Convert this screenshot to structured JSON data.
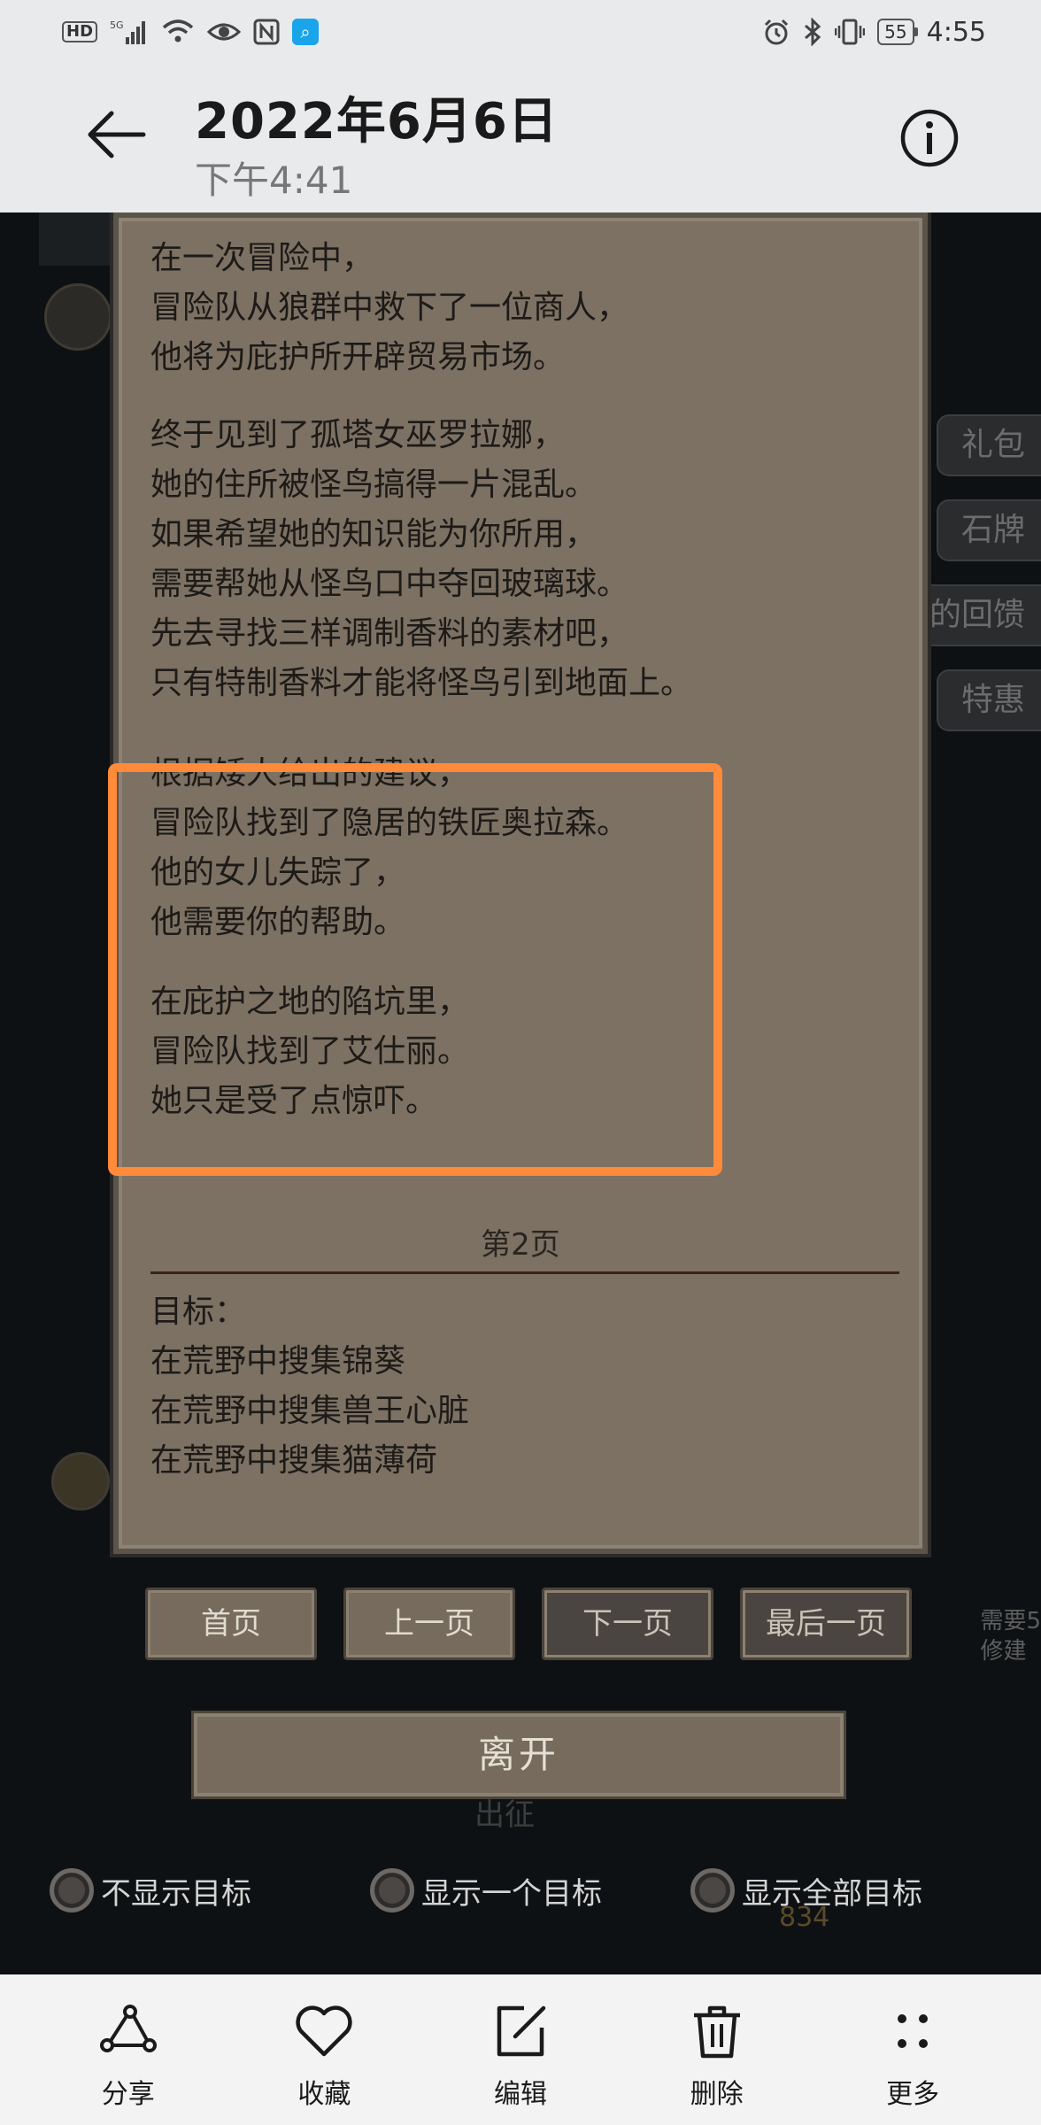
{
  "status_bar": {
    "left_badges": [
      "HD",
      "5G"
    ],
    "time": "4:55",
    "battery": "55"
  },
  "header": {
    "title": "2022年6月6日",
    "subtitle": "下午4:41"
  },
  "game": {
    "side_tags": [
      "礼包",
      "石牌",
      "的回馈",
      "特惠"
    ],
    "story_paragraphs": [
      [
        "在一次冒险中，",
        "冒险队从狼群中救下了一位商人，",
        "他将为庇护所开辟贸易市场。"
      ],
      [
        "终于见到了孤塔女巫罗拉娜，",
        "她的住所被怪鸟搞得一片混乱。",
        "如果希望她的知识能为你所用，",
        "需要帮她从怪鸟口中夺回玻璃球。",
        "先去寻找三样调制香料的素材吧，",
        "只有特制香料才能将怪鸟引到地面上。"
      ],
      [
        "根据矮人给出的建议，",
        "冒险队找到了隐居的铁匠奥拉森。",
        "他的女儿失踪了，",
        "他需要你的帮助。"
      ],
      [
        "在庇护之地的陷坑里，",
        "冒险队找到了艾仕丽。",
        "她只是受了点惊吓。"
      ]
    ],
    "page_label": "第2页",
    "goals_title": "目标：",
    "goals": [
      "在荒野中搜集锦葵",
      "在荒野中搜集兽王心脏",
      "在荒野中搜集猫薄荷"
    ],
    "nav_buttons": [
      "首页",
      "上一页",
      "下一页",
      "最后一页"
    ],
    "leave_button": "离开",
    "behind_text": "出征",
    "filters": [
      "不显示目标",
      "显示一个目标",
      "显示全部目标"
    ],
    "coin_text": "834",
    "right_hint": [
      "需要5",
      "修建"
    ]
  },
  "toolbar": {
    "items": [
      {
        "label": "分享",
        "icon": "share-icon"
      },
      {
        "label": "收藏",
        "icon": "heart-icon"
      },
      {
        "label": "编辑",
        "icon": "edit-icon"
      },
      {
        "label": "删除",
        "icon": "trash-icon"
      },
      {
        "label": "更多",
        "icon": "more-icon"
      }
    ]
  },
  "colors": {
    "highlight": "#ff8a3a",
    "parchment": "#7c7163",
    "header_bg": "#e9eaec"
  }
}
